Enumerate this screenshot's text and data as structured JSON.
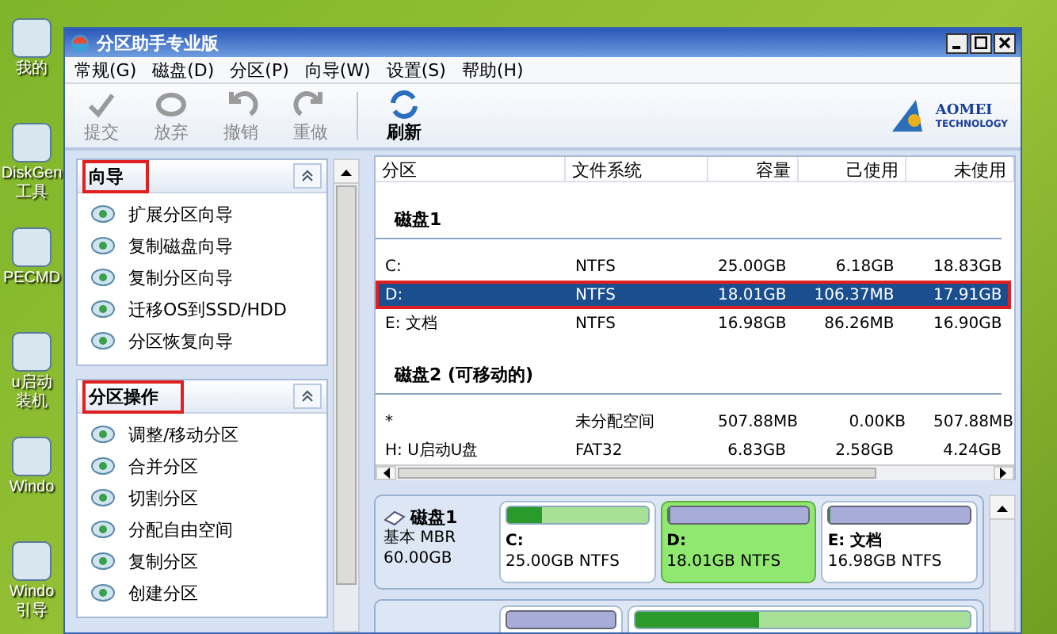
{
  "desktop_icons": [
    {
      "lines": [
        "我的"
      ]
    },
    {
      "lines": [
        "DiskGen",
        "工具"
      ]
    },
    {
      "lines": [
        "PECMD"
      ]
    },
    {
      "lines": [
        "u启动",
        "装机"
      ]
    },
    {
      "lines": [
        "Windo"
      ]
    },
    {
      "lines": [
        "Windo",
        "引导"
      ]
    }
  ],
  "window": {
    "title": "分区助手专业版"
  },
  "menu": [
    "常规(G)",
    "磁盘(D)",
    "分区(P)",
    "向导(W)",
    "设置(S)",
    "帮助(H)"
  ],
  "toolbar": [
    {
      "label": "提交",
      "kind": "check",
      "disabled": true
    },
    {
      "label": "放弃",
      "kind": "discard",
      "disabled": true
    },
    {
      "label": "撤销",
      "kind": "undo",
      "disabled": true
    },
    {
      "label": "重做",
      "kind": "redo",
      "disabled": true
    },
    {
      "label": "刷新",
      "kind": "refresh",
      "disabled": false
    }
  ],
  "logo": {
    "name": "AOMEI",
    "tagline": "TECHNOLOGY"
  },
  "side_panels": [
    {
      "title": "向导",
      "annotated": true,
      "items": [
        "扩展分区向导",
        "复制磁盘向导",
        "复制分区向导",
        "迁移OS到SSD/HDD",
        "分区恢复向导"
      ]
    },
    {
      "title": "分区操作",
      "annotated": true,
      "items": [
        "调整/移动分区",
        "合并分区",
        "切割分区",
        "分配自由空间",
        "复制分区",
        "创建分区"
      ]
    }
  ],
  "table": {
    "columns": [
      "分区",
      "文件系统",
      "容量",
      "己使用",
      "未使用"
    ],
    "groups": [
      {
        "name": "磁盘1",
        "rows": [
          {
            "cells": [
              "C:",
              "NTFS",
              "25.00GB",
              "6.18GB",
              "18.83GB"
            ],
            "selected": false
          },
          {
            "cells": [
              "D:",
              "NTFS",
              "18.01GB",
              "106.37MB",
              "17.91GB"
            ],
            "selected": true
          },
          {
            "cells": [
              "E: 文档",
              "NTFS",
              "16.98GB",
              "86.26MB",
              "16.90GB"
            ],
            "selected": false
          }
        ]
      },
      {
        "name": "磁盘2 (可移动的)",
        "rows": [
          {
            "cells": [
              "*",
              "未分配空间",
              "507.88MB",
              "0.00KB",
              "507.88MB"
            ],
            "selected": false
          },
          {
            "cells": [
              "H: U启动U盘",
              "FAT32",
              "6.83GB",
              "2.58GB",
              "4.24GB"
            ],
            "selected": false
          }
        ]
      }
    ]
  },
  "disk_map": [
    {
      "name": "磁盘1",
      "type": "基本 MBR",
      "size": "60.00GB",
      "partitions": [
        {
          "name": "C:",
          "info": "25.00GB NTFS",
          "level": 0.25,
          "selected": false
        },
        {
          "name": "D:",
          "info": "18.01GB NTFS",
          "level": 0.01,
          "selected": true
        },
        {
          "name": "E: 文档",
          "info": "16.98GB NTFS",
          "level": 0.01,
          "selected": false
        }
      ]
    },
    {
      "partitions": [
        {
          "level": 0,
          "selected": false
        },
        {
          "level": 0.37,
          "selected": false
        }
      ]
    }
  ]
}
